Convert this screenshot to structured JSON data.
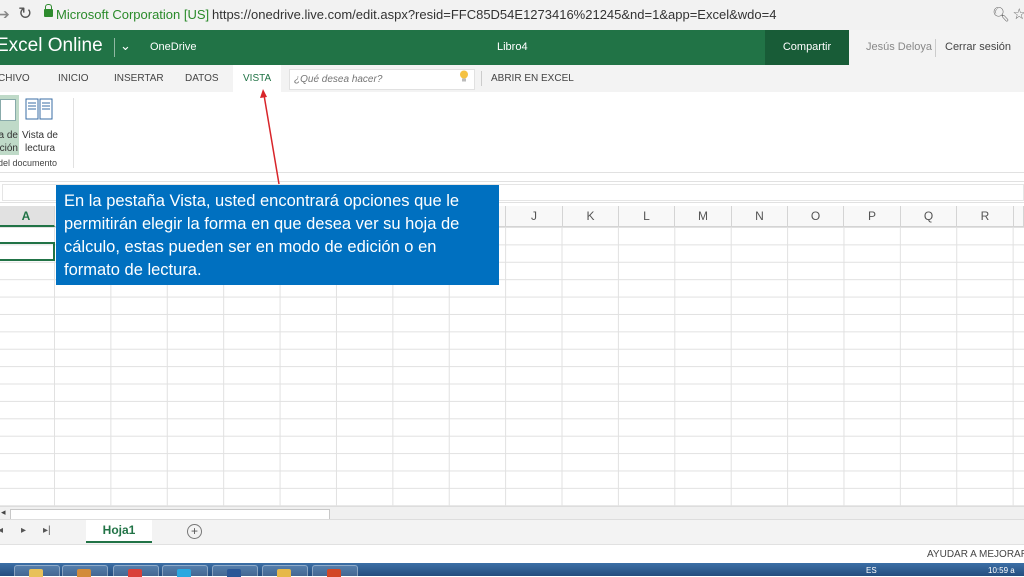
{
  "browser": {
    "ev_badge": "Microsoft Corporation [US]",
    "url": "https://onedrive.live.com/edit.aspx?resid=FFC85D54E1273416%21245&nd=1&app=Excel&wdo=4"
  },
  "header": {
    "app_name": "Excel Online",
    "location": "OneDrive",
    "doc_title": "Libro4",
    "share_label": "Compartir",
    "user_name": "Jesús Deloya",
    "sign_out": "Cerrar sesión",
    "accent_color": "#217346"
  },
  "ribbon": {
    "tabs": [
      "CHIVO",
      "INICIO",
      "INSERTAR",
      "DATOS",
      "VISTA"
    ],
    "active_tab": "VISTA",
    "tell_me_placeholder": "¿Qué desea hacer?",
    "open_in_excel": "ABRIR EN EXCEL",
    "edit_view_label": "a de\nción",
    "read_view_label": "Vista de\nlectura",
    "group_label": "del documento"
  },
  "grid": {
    "columns": [
      "A",
      "J",
      "K",
      "L",
      "M",
      "N",
      "O",
      "P",
      "Q",
      "R"
    ],
    "selected_column": "A"
  },
  "sheets": {
    "tabs": [
      "Hoja1"
    ],
    "add_label": "+"
  },
  "status": {
    "help": "AYUDAR A MEJORAR O"
  },
  "callout": {
    "text": "En la pestaña Vista, usted encontrará opciones que le permitirán elegir la forma en que desea ver su hoja de cálculo, estas pueden ser en modo de edición o en formato de lectura.",
    "color": "#0070c0"
  },
  "taskbar": {
    "lang": "ES",
    "clock": "10:59 a"
  }
}
